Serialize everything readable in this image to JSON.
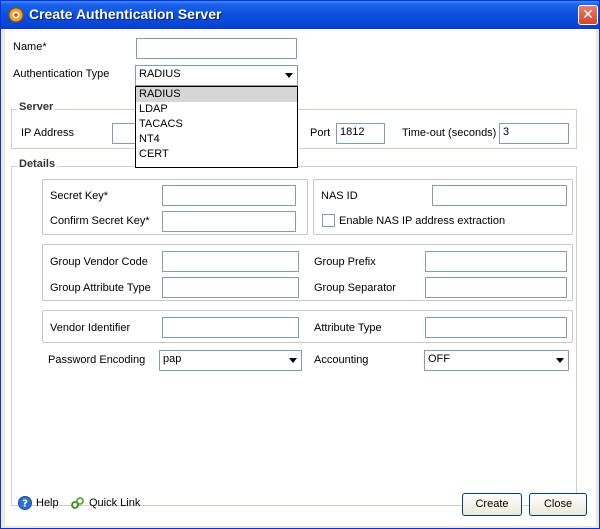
{
  "window": {
    "title": "Create Authentication Server",
    "close_glyph": "✕"
  },
  "form": {
    "name_label": "Name*",
    "name_value": "",
    "auth_type_label": "Authentication Type",
    "auth_type_value": "RADIUS",
    "auth_type_options": [
      "RADIUS",
      "LDAP",
      "TACACS",
      "NT4",
      "CERT"
    ]
  },
  "server": {
    "legend": "Server",
    "ip_label": "IP Address",
    "ip_value": "",
    "port_label": "Port",
    "port_value": "1812",
    "timeout_label": "Time-out (seconds)",
    "timeout_value": "3"
  },
  "details": {
    "legend": "Details",
    "secret_key_label": "Secret Key*",
    "confirm_secret_key_label": "Confirm Secret Key*",
    "nas_id_label": "NAS ID",
    "enable_nas_label": "Enable NAS IP address extraction",
    "group_vendor_code_label": "Group Vendor Code",
    "group_prefix_label": "Group Prefix",
    "group_attribute_type_label": "Group Attribute Type",
    "group_separator_label": "Group Separator",
    "vendor_identifier_label": "Vendor Identifier",
    "attribute_type_label": "Attribute Type",
    "password_encoding_label": "Password Encoding",
    "password_encoding_value": "pap",
    "accounting_label": "Accounting",
    "accounting_value": "OFF"
  },
  "footer": {
    "help_label": "Help",
    "quick_link_label": "Quick Link",
    "create_label": "Create",
    "close_label": "Close"
  }
}
